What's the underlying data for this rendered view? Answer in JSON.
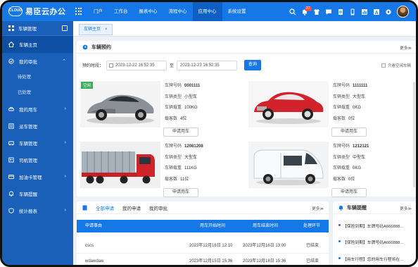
{
  "app": {
    "logo_mark": "CLOUD",
    "name": "易臣云办公"
  },
  "colors": {
    "primary": "#1677e6",
    "sidebar": "#1a5fb8",
    "free_tag": "#3aae5a",
    "badge": "#f04b4b"
  },
  "topnav": {
    "items": [
      "门户",
      "工作台",
      "报表中心",
      "流程中心",
      "应用中心",
      "系统设置"
    ],
    "active_index": 4,
    "notification_count": "27"
  },
  "sidebar": {
    "title": "车辆管理",
    "items": [
      {
        "label": "车辆主页",
        "icon": "home-icon",
        "active": true
      },
      {
        "label": "我的审批",
        "icon": "approval-icon",
        "expanded": true
      },
      {
        "label": "待处理",
        "sub": true
      },
      {
        "label": "已处理",
        "sub": true
      },
      {
        "label": "我的用车",
        "icon": "car-icon"
      },
      {
        "label": "派车管理",
        "icon": "dispatch-icon"
      },
      {
        "label": "车辆管理",
        "icon": "vehicle-icon"
      },
      {
        "label": "司机管理",
        "icon": "driver-icon"
      },
      {
        "label": "加油卡管理",
        "icon": "card-icon"
      },
      {
        "label": "车辆提醒",
        "icon": "reminder-icon"
      },
      {
        "label": "统计报表",
        "icon": "report-icon"
      }
    ]
  },
  "tabs": [
    {
      "label": "车辆主页",
      "close": "×"
    }
  ],
  "booking": {
    "title": "车辆预约",
    "more": "更多≫",
    "time_label": "预约时段：",
    "start": "2023-12-22 16:52:35",
    "to": "至",
    "end": "2023-12-23 16:52:35",
    "query": "查询",
    "only_free": "只看空闲车辆",
    "free_tag": "空闲",
    "field_plate": "车牌号码",
    "field_type": "车辆类型",
    "field_load": "车辆载重",
    "field_seats": "载客数",
    "apply": "申请用车",
    "vehicles": [
      {
        "plate": "0001111",
        "type": "小型车",
        "load": "100KG",
        "seats": "4位",
        "free": true,
        "img": "silver-sports-car"
      },
      {
        "plate": "1111111",
        "type": "大型车",
        "load": "0KG",
        "seats": "0位",
        "free": false,
        "img": "red-classic-car"
      },
      {
        "plate": "12081208",
        "type": "大型车",
        "load": "111KG",
        "seats": "11位",
        "free": false,
        "img": "red-truck"
      },
      {
        "plate": "1212121",
        "type": "中型车",
        "load": "0KG",
        "seats": "0位",
        "free": false,
        "img": "white-van"
      }
    ]
  },
  "requests": {
    "tabs": [
      "全部申请",
      "我的申请",
      "我的审批"
    ],
    "more": "更多≫",
    "columns": [
      "申请事由",
      "用车开始时间",
      "用车结束时间",
      "处理环节"
    ],
    "rows": [
      {
        "reason": "cscs",
        "start": "2023年12月16日 12:10",
        "end": "2023年12月16日 13:00",
        "stage": "已结束"
      },
      {
        "reason": "wdawdaw",
        "start": "2023年12月15日 15:36",
        "end": "2023年12月18日 15:36",
        "stage": "已结束"
      }
    ]
  },
  "notice": {
    "title": "车辆提醒",
    "more": "更多≫",
    "items": [
      "【保险到期】车牌号码A666888…",
      "【保险到期】车牌号码A666888…",
      "【用车行程】您的用车行程将在…"
    ]
  }
}
